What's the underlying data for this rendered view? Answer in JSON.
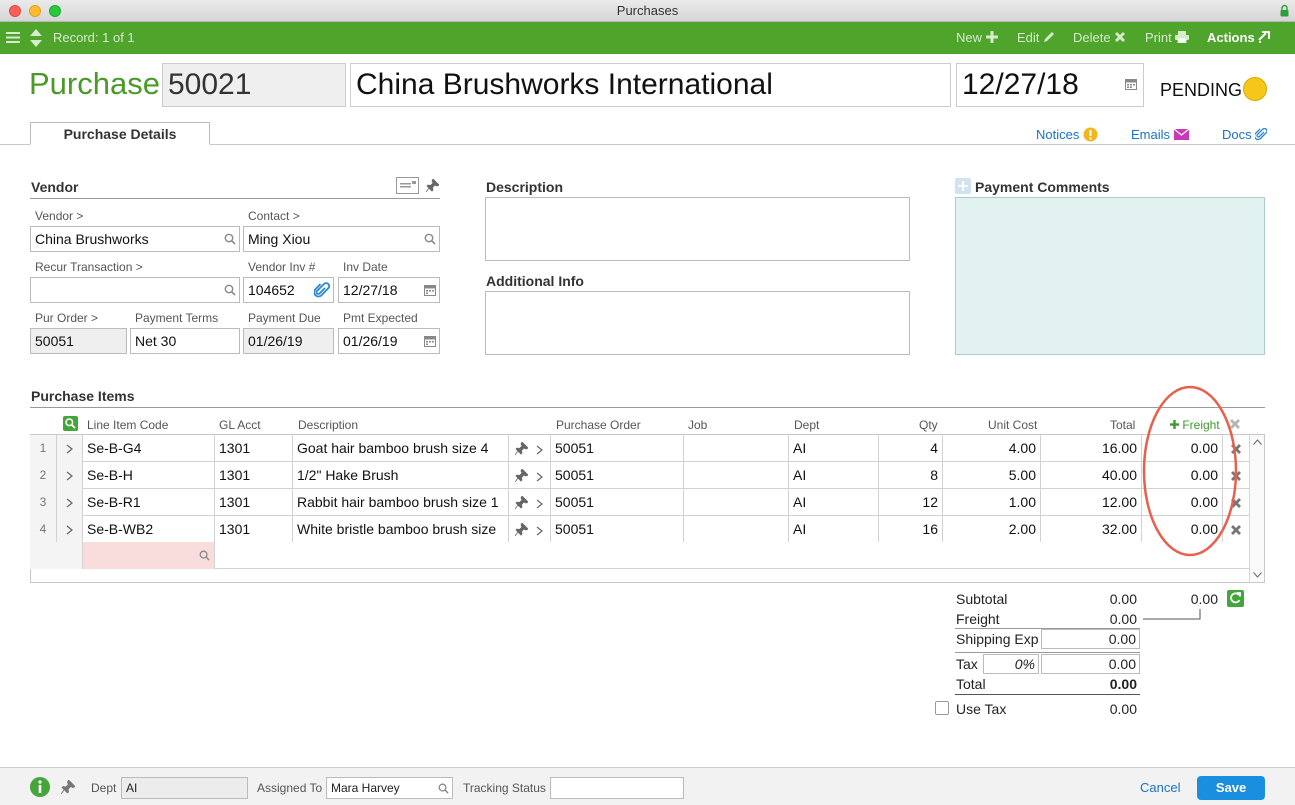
{
  "window": {
    "title": "Purchases"
  },
  "toolbar": {
    "record": "Record: 1 of 1",
    "new": "New",
    "edit": "Edit",
    "delete": "Delete",
    "print": "Print",
    "actions": "Actions"
  },
  "header": {
    "label": "Purchase:",
    "number": "50021",
    "vendor_name": "China Brushworks International",
    "date": "12/27/18",
    "status": "PENDING"
  },
  "tabs": {
    "details": "Purchase Details"
  },
  "links": {
    "notices": "Notices",
    "emails": "Emails",
    "docs": "Docs"
  },
  "vendor": {
    "title": "Vendor",
    "vendor_label": "Vendor >",
    "vendor_value": "China Brushworks",
    "contact_label": "Contact >",
    "contact_value": "Ming Xiou",
    "recur_label": "Recur Transaction >",
    "recur_value": "",
    "vendor_inv_label": "Vendor Inv #",
    "vendor_inv_value": "104652",
    "inv_date_label": "Inv Date",
    "inv_date_value": "12/27/18",
    "pur_order_label": "Pur Order >",
    "pur_order_value": "50051",
    "payment_terms_label": "Payment Terms",
    "payment_terms_value": "Net 30",
    "payment_due_label": "Payment Due",
    "payment_due_value": "01/26/19",
    "pmt_expected_label": "Pmt Expected",
    "pmt_expected_value": "01/26/19"
  },
  "description": {
    "title": "Description",
    "additional_title": "Additional Info"
  },
  "payment_comments": {
    "title": "Payment Comments"
  },
  "items": {
    "title": "Purchase Items",
    "columns": {
      "code": "Line Item Code",
      "gl": "GL Acct",
      "desc": "Description",
      "po": "Purchase Order",
      "job": "Job",
      "dept": "Dept",
      "qty": "Qty",
      "unit": "Unit Cost",
      "total": "Total",
      "freight": "Freight"
    },
    "rows": [
      {
        "n": "1",
        "code": "Se-B-G4",
        "gl": "1301",
        "desc": "Goat hair bamboo brush size 4",
        "po": "50051",
        "job": "",
        "dept": "AI",
        "qty": "4",
        "unit": "4.00",
        "total": "16.00",
        "freight": "0.00"
      },
      {
        "n": "2",
        "code": "Se-B-H",
        "gl": "1301",
        "desc": "1/2\" Hake Brush",
        "po": "50051",
        "job": "",
        "dept": "AI",
        "qty": "8",
        "unit": "5.00",
        "total": "40.00",
        "freight": "0.00"
      },
      {
        "n": "3",
        "code": "Se-B-R1",
        "gl": "1301",
        "desc": "Rabbit hair bamboo brush size 1",
        "po": "50051",
        "job": "",
        "dept": "AI",
        "qty": "12",
        "unit": "1.00",
        "total": "12.00",
        "freight": "0.00"
      },
      {
        "n": "4",
        "code": "Se-B-WB2",
        "gl": "1301",
        "desc": "White bristle bamboo brush size",
        "po": "50051",
        "job": "",
        "dept": "AI",
        "qty": "16",
        "unit": "2.00",
        "total": "32.00",
        "freight": "0.00"
      }
    ]
  },
  "totals": {
    "subtotal_label": "Subtotal",
    "subtotal": "0.00",
    "freight_total": "0.00",
    "freight_label": "Freight",
    "freight": "0.00",
    "shipping_label": "Shipping Exp",
    "shipping": "0.00",
    "tax_label": "Tax",
    "tax_rate": "0%",
    "tax": "0.00",
    "total_label": "Total",
    "total": "0.00",
    "use_tax_label": "Use Tax",
    "use_tax": "0.00"
  },
  "footer": {
    "dept_label": "Dept",
    "dept_value": "AI",
    "assigned_label": "Assigned To",
    "assigned_value": "Mara Harvey",
    "tracking_label": "Tracking Status",
    "tracking_value": "",
    "cancel": "Cancel",
    "save": "Save"
  },
  "colors": {
    "toolbar": "#4fa42c",
    "accent_blue": "#1a73c6",
    "status": "#f7c61a",
    "annotation": "#e8604c",
    "payment_comments_bg": "#e1f2f1"
  }
}
